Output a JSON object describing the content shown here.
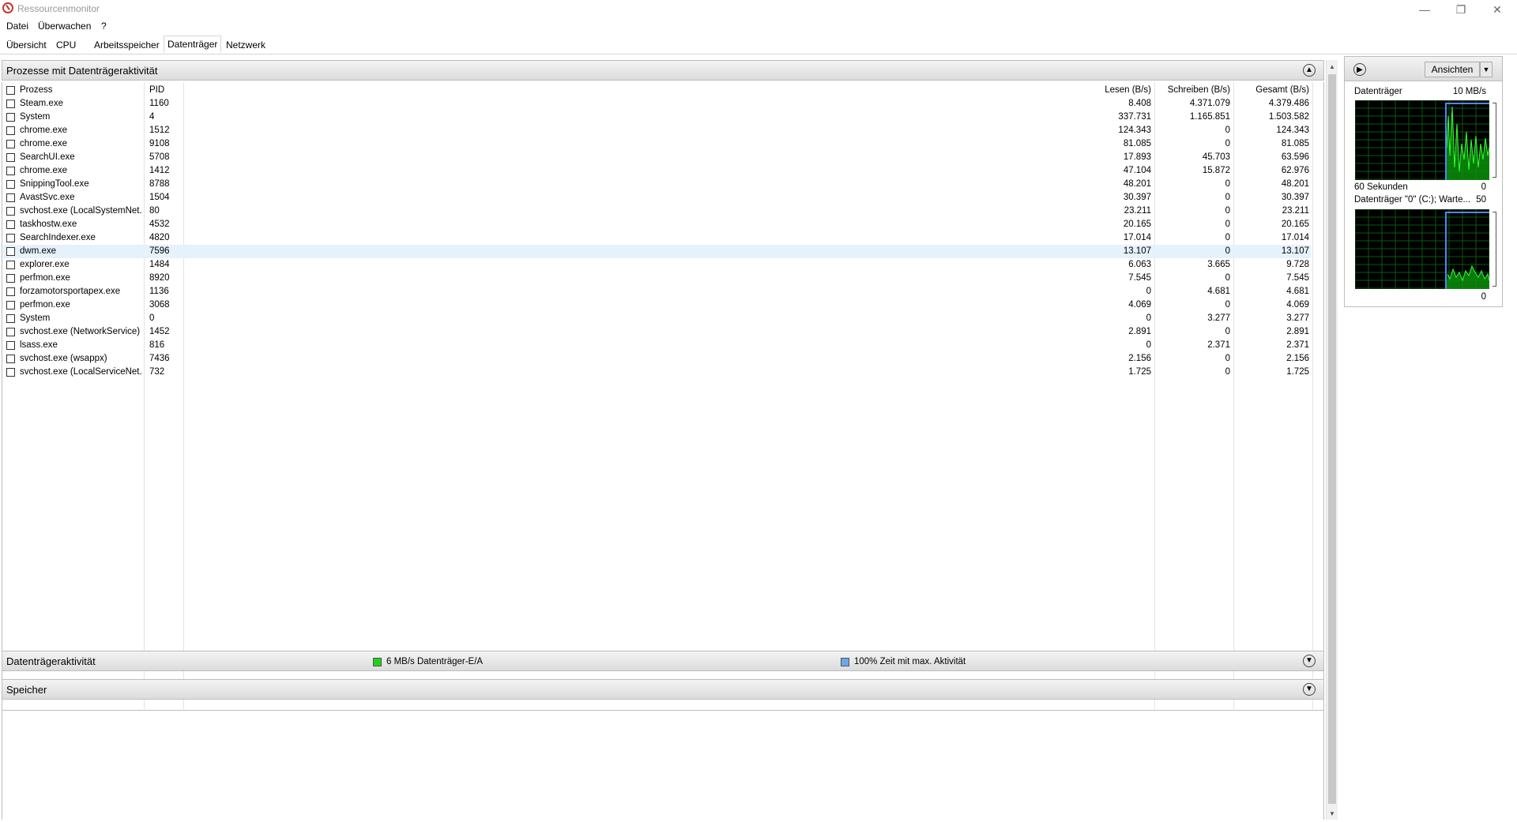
{
  "window": {
    "title": "Ressourcenmonitor",
    "min": "—",
    "max": "❐",
    "close": "✕"
  },
  "menu": [
    "Datei",
    "Überwachen",
    "?"
  ],
  "tabs": [
    "Übersicht",
    "CPU",
    "Arbeitsspeicher",
    "Datenträger",
    "Netzwerk"
  ],
  "active_tab": "Datenträger",
  "processes_section": {
    "title": "Prozesse mit Datenträgeraktivität",
    "columns": [
      "Prozess",
      "PID",
      "Lesen (B/s)",
      "Schreiben (B/s)",
      "Gesamt (B/s)"
    ],
    "rows": [
      [
        "Steam.exe",
        "1160",
        "8.408",
        "4.371.079",
        "4.379.486"
      ],
      [
        "System",
        "4",
        "337.731",
        "1.165.851",
        "1.503.582"
      ],
      [
        "chrome.exe",
        "1512",
        "124.343",
        "0",
        "124.343"
      ],
      [
        "chrome.exe",
        "9108",
        "81.085",
        "0",
        "81.085"
      ],
      [
        "SearchUI.exe",
        "5708",
        "17.893",
        "45.703",
        "63.596"
      ],
      [
        "chrome.exe",
        "1412",
        "47.104",
        "15.872",
        "62.976"
      ],
      [
        "SnippingTool.exe",
        "8788",
        "48.201",
        "0",
        "48.201"
      ],
      [
        "AvastSvc.exe",
        "1504",
        "30.397",
        "0",
        "30.397"
      ],
      [
        "svchost.exe (LocalSystemNet...",
        "80",
        "23.211",
        "0",
        "23.211"
      ],
      [
        "taskhostw.exe",
        "4532",
        "20.165",
        "0",
        "20.165"
      ],
      [
        "SearchIndexer.exe",
        "4820",
        "17.014",
        "0",
        "17.014"
      ],
      [
        "dwm.exe",
        "7596",
        "13.107",
        "0",
        "13.107"
      ],
      [
        "explorer.exe",
        "1484",
        "6.063",
        "3.665",
        "9.728"
      ],
      [
        "perfmon.exe",
        "8920",
        "7.545",
        "0",
        "7.545"
      ],
      [
        "forzamotorsportapex.exe",
        "1136",
        "0",
        "4.681",
        "4.681"
      ],
      [
        "perfmon.exe",
        "3068",
        "4.069",
        "0",
        "4.069"
      ],
      [
        "System",
        "0",
        "0",
        "3.277",
        "3.277"
      ],
      [
        "svchost.exe (NetworkService)",
        "1452",
        "2.891",
        "0",
        "2.891"
      ],
      [
        "lsass.exe",
        "816",
        "0",
        "2.371",
        "2.371"
      ],
      [
        "svchost.exe (wsappx)",
        "7436",
        "2.156",
        "0",
        "2.156"
      ],
      [
        "svchost.exe (LocalServiceNet...",
        "732",
        "1.725",
        "0",
        "1.725"
      ]
    ],
    "highlight_row": 11
  },
  "activity_section": {
    "title": "Datenträgeraktivität",
    "legend1": "6 MB/s Datenträger-E/A",
    "legend1_color": "#1fd11f",
    "legend2": "100% Zeit mit max. Aktivität",
    "legend2_color": "#6aa8e8"
  },
  "storage_section": {
    "title": "Speicher"
  },
  "side_panel": {
    "views_button": "Ansichten",
    "graph1": {
      "label": "Datenträger",
      "max": "10 MB/s",
      "time": "60 Sekunden",
      "min": "0"
    },
    "graph2": {
      "label": "Datenträger \"0\" (C:); Warte...",
      "max": "50",
      "min": "0"
    }
  }
}
